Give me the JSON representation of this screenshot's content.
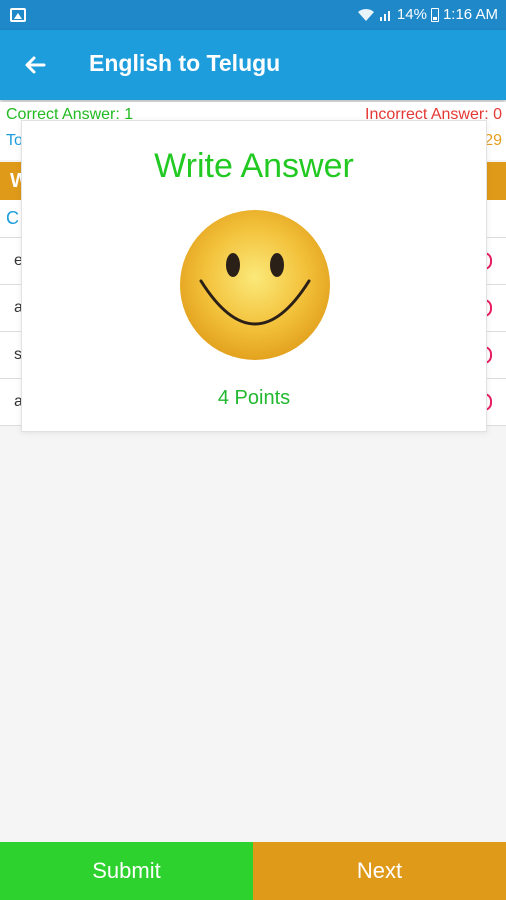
{
  "status_bar": {
    "battery": "14%",
    "time": "1:16 AM"
  },
  "app_bar": {
    "title": "English to Telugu"
  },
  "score": {
    "correct_label": "Correct Answer: 1",
    "incorrect_label": "Incorrect Answer: 0",
    "total_partial": "To",
    "total_value_partial": "29"
  },
  "section_header": {
    "partial_label": "W"
  },
  "column_header": {
    "partial_label": "C"
  },
  "rows": [
    {
      "left_partial": "e"
    },
    {
      "left_partial": "a"
    },
    {
      "left_partial": "s"
    },
    {
      "left_partial": "a"
    }
  ],
  "dialog": {
    "title": "Write Answer",
    "icon": "smiley-face-icon",
    "points": "4 Points"
  },
  "buttons": {
    "submit": "Submit",
    "next": "Next"
  },
  "colors": {
    "app_bar": "#1e9ddc",
    "success": "#22c922",
    "error": "#e53935",
    "accent_orange": "#e09a1a"
  }
}
